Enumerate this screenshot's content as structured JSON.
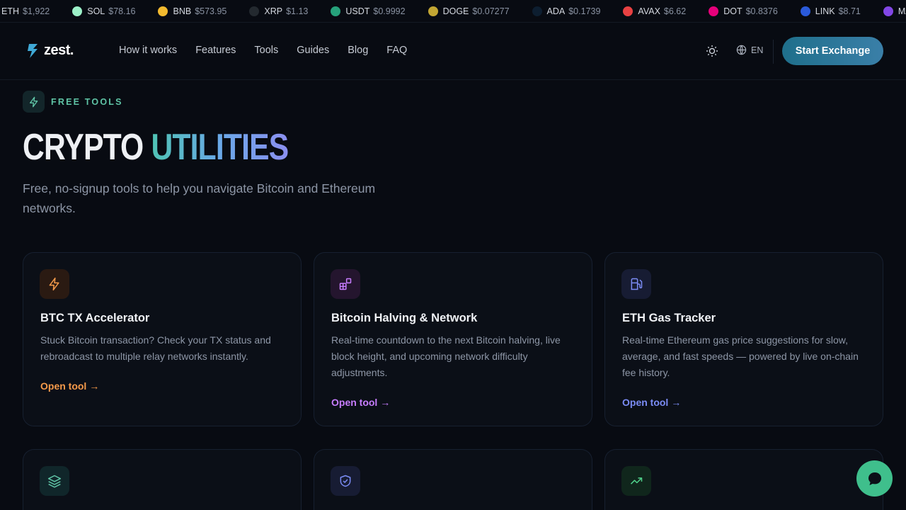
{
  "ticker": [
    {
      "sym": "ETH",
      "price": "$1,922",
      "color": "#627eea",
      "hideIcon": true
    },
    {
      "sym": "SOL",
      "price": "$78.16",
      "color": "#9cf0c8"
    },
    {
      "sym": "BNB",
      "price": "$573.95",
      "color": "#f3ba2f"
    },
    {
      "sym": "XRP",
      "price": "$1.13",
      "color": "#23292f"
    },
    {
      "sym": "USDT",
      "price": "$0.9992",
      "color": "#26a17b"
    },
    {
      "sym": "DOGE",
      "price": "$0.07277",
      "color": "#c2a633"
    },
    {
      "sym": "ADA",
      "price": "$0.1739",
      "color": "#0d1e30"
    },
    {
      "sym": "AVAX",
      "price": "$6.62",
      "color": "#e84142"
    },
    {
      "sym": "DOT",
      "price": "$0.8376",
      "color": "#e6007a"
    },
    {
      "sym": "LINK",
      "price": "$8.71",
      "color": "#2a5ada"
    },
    {
      "sym": "MAT",
      "price": "",
      "color": "#8247e5"
    }
  ],
  "header": {
    "logo": "zest.",
    "nav": [
      "How it works",
      "Features",
      "Tools",
      "Guides",
      "Blog",
      "FAQ"
    ],
    "lang": "EN",
    "cta": "Start Exchange"
  },
  "hero": {
    "badge": "FREE TOOLS",
    "title_a": "CRYPTO ",
    "title_b": "UTILITIES",
    "subtitle": "Free, no-signup tools to help you navigate Bitcoin and Ethereum networks."
  },
  "cards": [
    {
      "title": "BTC TX Accelerator",
      "desc": "Stuck Bitcoin transaction? Check your TX status and rebroadcast to multiple relay networks instantly.",
      "link": "Open tool →",
      "accent": "#f59a4a",
      "iconBg": "#2a1a12",
      "icon": "bolt-icon"
    },
    {
      "title": "Bitcoin Halving & Network",
      "desc": "Real-time countdown to the next Bitcoin halving, live block height, and upcoming network difficulty adjustments.",
      "link": "Open tool →",
      "accent": "#c77dff",
      "iconBg": "#24152e",
      "icon": "blocks-icon"
    },
    {
      "title": "ETH Gas Tracker",
      "desc": "Real-time Ethereum gas price suggestions for slow, average, and fast speeds — powered by live on-chain fee history.",
      "link": "Open tool →",
      "accent": "#7b8cf5",
      "iconBg": "#171c33",
      "icon": "fuel-icon"
    }
  ],
  "cards_row2": [
    {
      "accent": "#5fc4a6",
      "iconBg": "#10262a",
      "icon": "layers-icon"
    },
    {
      "accent": "#7b8cf5",
      "iconBg": "#171c33",
      "icon": "shield-check-icon"
    },
    {
      "accent": "#4fd08a",
      "iconBg": "#10261c",
      "icon": "trending-up-icon"
    }
  ]
}
